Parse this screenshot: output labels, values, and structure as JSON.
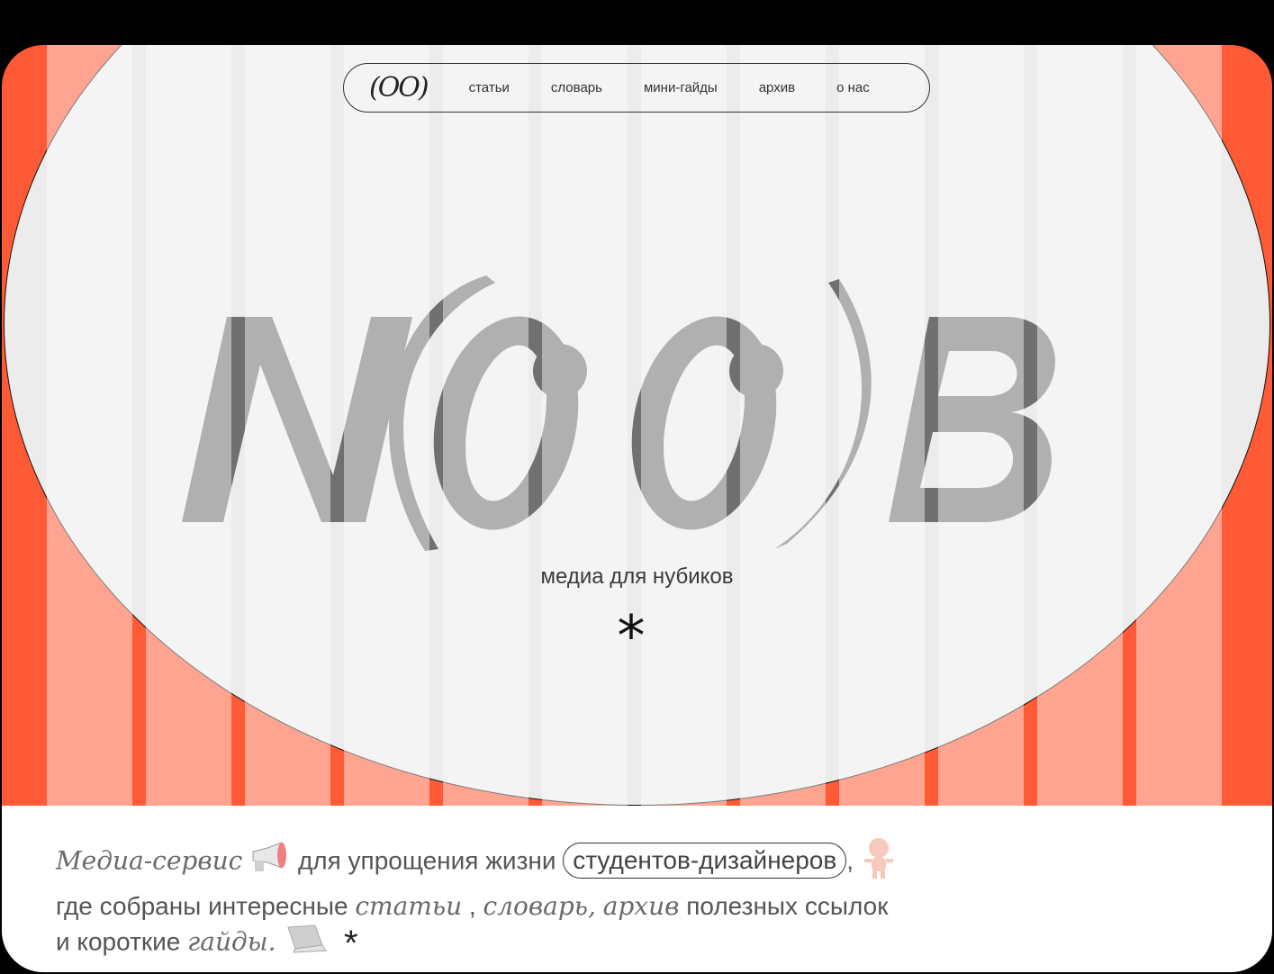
{
  "nav": {
    "logo": "(OO)",
    "items": [
      {
        "label": "статьи"
      },
      {
        "label": "словарь"
      },
      {
        "label": "мини-гайды"
      },
      {
        "label": "архив"
      },
      {
        "label": "о нас"
      }
    ]
  },
  "hero": {
    "logo_text": "N(OO)B",
    "tagline": "медиа для нубиков",
    "asterisk": "*"
  },
  "description": {
    "part1": "Медиа-сервис",
    "part2": "для упрощения жизни",
    "pill": "студентов-дизайнеров",
    "comma1": ",",
    "part3": "где собраны интересные",
    "articles": "статьи",
    "comma2": " , ",
    "dictionary": "словарь,",
    "archive": "архив",
    "part4": "полезных ссылок",
    "part5": "и короткие",
    "guides": "гайды.",
    "asterisk": "*"
  },
  "colors": {
    "accent": "#ff5a36",
    "oval": "#ececec",
    "logo_gray": "#707070"
  },
  "icons": [
    "megaphone-icon",
    "doll-icon",
    "laptop-icon"
  ]
}
